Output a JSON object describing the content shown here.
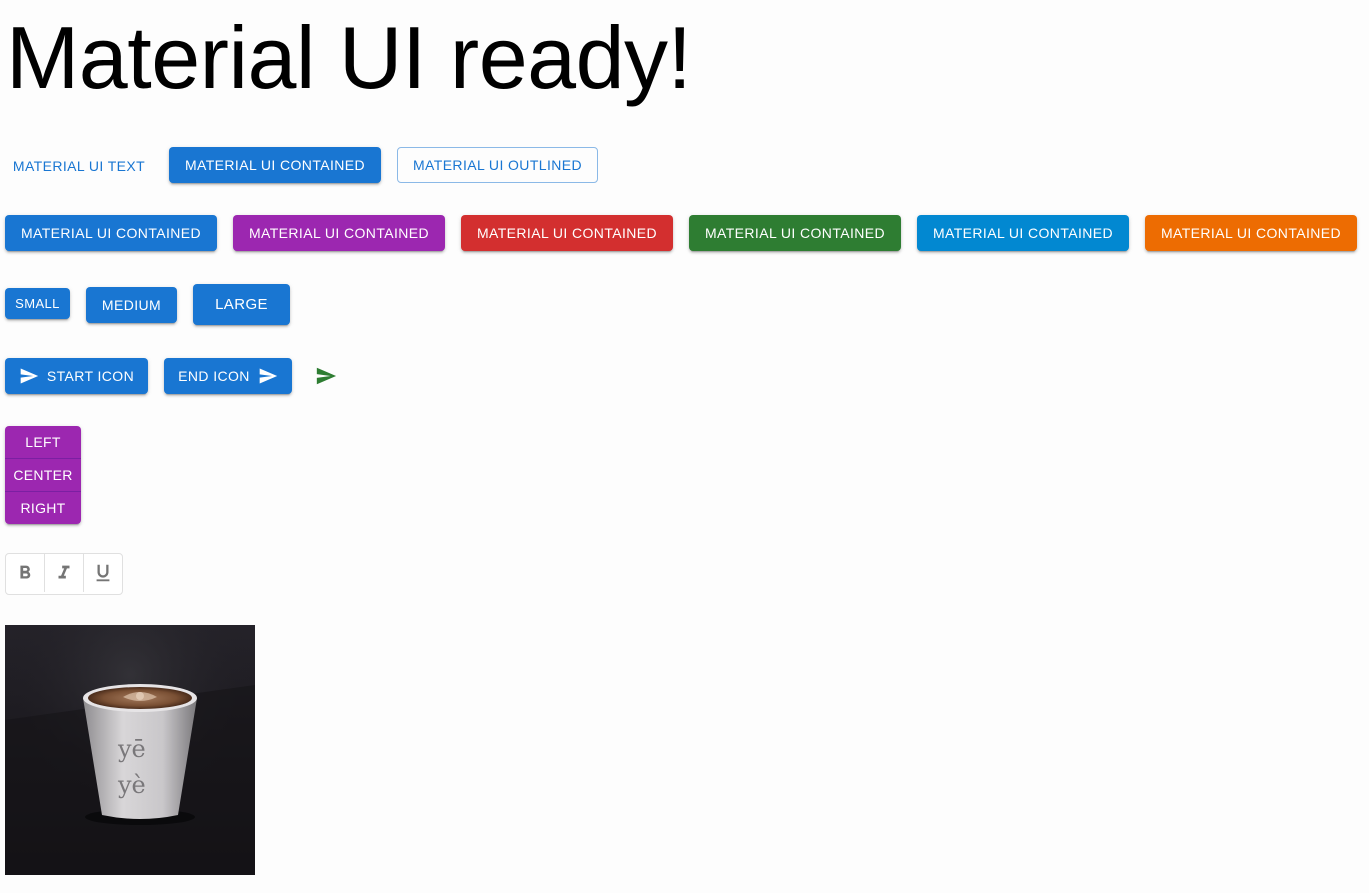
{
  "page": {
    "title": "Material UI ready!"
  },
  "variant_row": {
    "text_label": "Material UI Text",
    "contained_label": "Material UI Contained",
    "outlined_label": "Material UI Outlined"
  },
  "color_row": {
    "buttons": [
      {
        "label": "Material UI Contained",
        "color": "#1976d2"
      },
      {
        "label": "Material UI Contained",
        "color": "#9c27b0"
      },
      {
        "label": "Material UI Contained",
        "color": "#d32f2f"
      },
      {
        "label": "Material UI Contained",
        "color": "#2e7d32"
      },
      {
        "label": "Material UI Contained",
        "color": "#0288d1"
      },
      {
        "label": "Material UI Contained",
        "color": "#ed6c02"
      }
    ]
  },
  "size_row": {
    "small_label": "Small",
    "medium_label": "Medium",
    "large_label": "Large"
  },
  "icon_row": {
    "start_label": "Start Icon",
    "end_label": "End Icon",
    "icon_name": "send-icon",
    "icon_button_color": "#2e7d32"
  },
  "vertical_group": {
    "items": [
      "Left",
      "Center",
      "Right"
    ],
    "color": "#9c27b0"
  },
  "format_toggles": {
    "items": [
      {
        "icon": "format-bold-icon"
      },
      {
        "icon": "format-italic-icon"
      },
      {
        "icon": "format-underline-icon"
      }
    ]
  },
  "colors": {
    "primary": "#1976d2",
    "secondary": "#9c27b0",
    "error": "#d32f2f",
    "success": "#2e7d32",
    "info": "#0288d1",
    "warning": "#ed6c02"
  }
}
